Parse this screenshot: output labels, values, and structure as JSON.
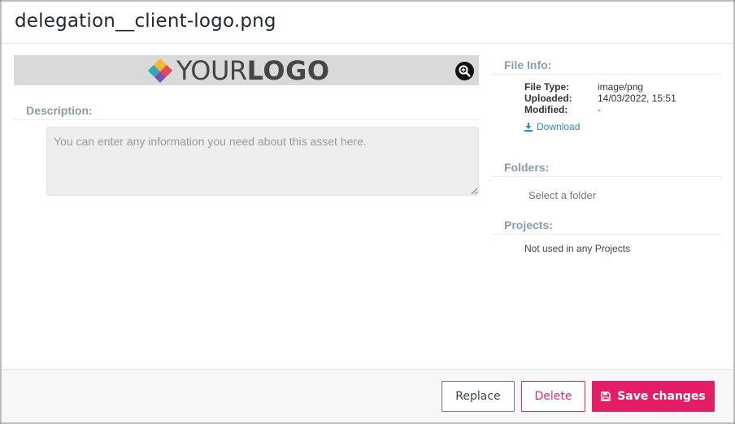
{
  "modal": {
    "title": "delegation__client-logo.png"
  },
  "preview": {
    "logo_text_light": "YOUR",
    "logo_text_bold": "LOGO",
    "zoom_icon": "zoom-in-icon"
  },
  "description": {
    "label": "Description:",
    "value": "",
    "placeholder": "You can enter any information you need about this asset here."
  },
  "file_info": {
    "label": "File Info:",
    "rows": [
      {
        "key": "File Type:",
        "value": "image/png"
      },
      {
        "key": "Uploaded:",
        "value": "14/03/2022, 15:51"
      },
      {
        "key": "Modified:",
        "value": "-"
      }
    ],
    "download_label": "Download",
    "download_icon": "download-icon"
  },
  "folders": {
    "label": "Folders:",
    "select_placeholder": "Select a folder"
  },
  "projects": {
    "label": "Projects:",
    "text": "Not used in any Projects"
  },
  "footer": {
    "replace_label": "Replace",
    "delete_label": "Delete",
    "save_label": "Save changes",
    "save_icon": "floppy-disk-icon"
  },
  "colors": {
    "accent": "#e31d66",
    "section_label": "#8a9bab",
    "link": "#2b8ac6"
  }
}
